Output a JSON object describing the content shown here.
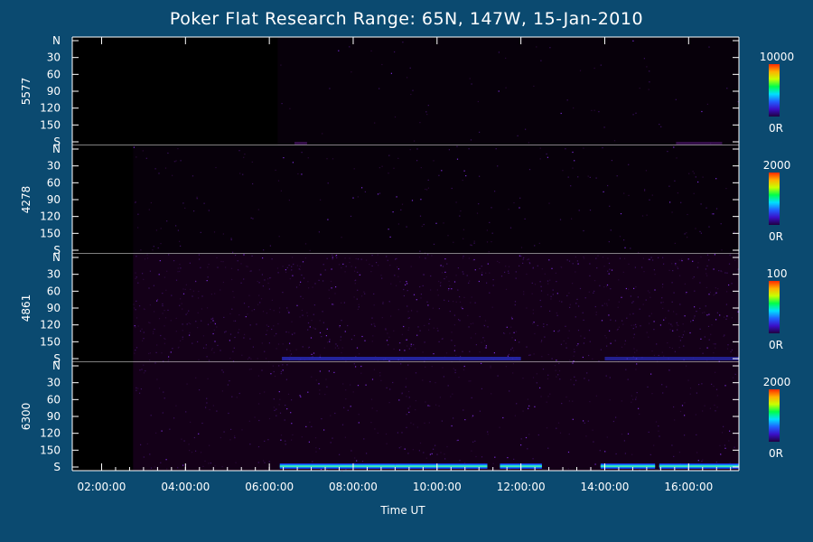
{
  "title": "Poker Flat Research Range: 65N, 147W, 15-Jan-2010",
  "chart_data": {
    "type": "heatmap",
    "title": "Poker Flat Research Range: 65N, 147W, 15-Jan-2010",
    "xlabel": "Time UT",
    "x_ticks": [
      "02:00:00",
      "04:00:00",
      "06:00:00",
      "08:00:00",
      "10:00:00",
      "12:00:00",
      "14:00:00",
      "16:00:00"
    ],
    "x_range_hours": [
      1.3,
      17.2
    ],
    "y_ticks": [
      "N",
      "30",
      "60",
      "90",
      "120",
      "150",
      "S"
    ],
    "y_range_deg": [
      0,
      180
    ],
    "colorbar_colors": [
      "#ff2a00",
      "#ffb000",
      "#c8ff00",
      "#00ff4a",
      "#00e0ff",
      "#2060ff",
      "#3a10c8",
      "#200040"
    ],
    "panels": [
      {
        "name": "5577",
        "scale_max": "10000",
        "scale_min": "0R",
        "data_start_hour": 6.2,
        "noise": 0.02,
        "band": [
          [
            6.6,
            6.9,
            0.12
          ],
          [
            15.7,
            16.8,
            0.12
          ]
        ]
      },
      {
        "name": "4278",
        "scale_max": "2000",
        "scale_min": "0R",
        "data_start_hour": 2.75,
        "noise": 0.07,
        "band": []
      },
      {
        "name": "4861",
        "scale_max": "100",
        "scale_min": "0R",
        "data_start_hour": 2.75,
        "noise": 0.3,
        "band": [
          [
            6.3,
            12.0,
            0.45
          ],
          [
            14.0,
            17.2,
            0.4
          ]
        ]
      },
      {
        "name": "6300",
        "scale_max": "2000",
        "scale_min": "0R",
        "data_start_hour": 2.75,
        "noise": 0.14,
        "band": [
          [
            6.25,
            9.0,
            0.85
          ],
          [
            9.0,
            11.2,
            0.75
          ],
          [
            11.5,
            12.5,
            0.7
          ],
          [
            13.9,
            15.2,
            0.7
          ],
          [
            15.3,
            17.2,
            0.8
          ]
        ]
      }
    ]
  }
}
